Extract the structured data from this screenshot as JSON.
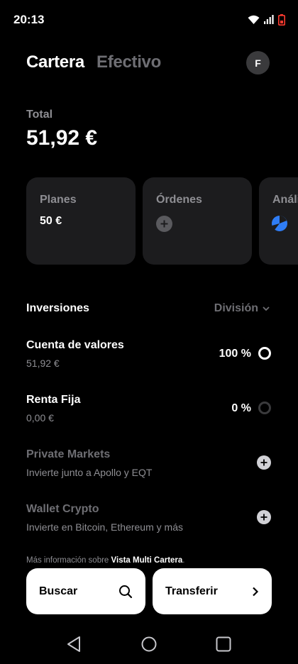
{
  "status_bar": {
    "time": "20:13"
  },
  "header": {
    "tab_active": "Cartera",
    "tab_inactive": "Efectivo",
    "avatar_initial": "F"
  },
  "total": {
    "label": "Total",
    "value": "51,92 €"
  },
  "cards": [
    {
      "title": "Planes",
      "value": "50 €"
    },
    {
      "title": "Órdenes"
    },
    {
      "title": "Análisis"
    }
  ],
  "investments": {
    "title": "Inversiones",
    "division_label": "División",
    "rows": [
      {
        "title": "Cuenta de valores",
        "subtitle": "51,92 €",
        "percent": "100 %"
      },
      {
        "title": "Renta Fija",
        "subtitle": "0,00 €",
        "percent": "0 %"
      },
      {
        "title": "Private Markets",
        "subtitle": "Invierte junto a Apollo y EQT"
      },
      {
        "title": "Wallet Crypto",
        "subtitle": "Invierte en Bitcoin, Ethereum y más"
      }
    ]
  },
  "more_info": {
    "prefix": "Más información sobre ",
    "link": "Vista Multi Cartera",
    "suffix": "."
  },
  "actions": {
    "search_label": "Buscar",
    "transfer_label": "Transferir"
  },
  "colors": {
    "background": "#000000",
    "card": "#1c1c1e",
    "muted": "#8e8e93",
    "accent_blue": "#2f7df6"
  }
}
